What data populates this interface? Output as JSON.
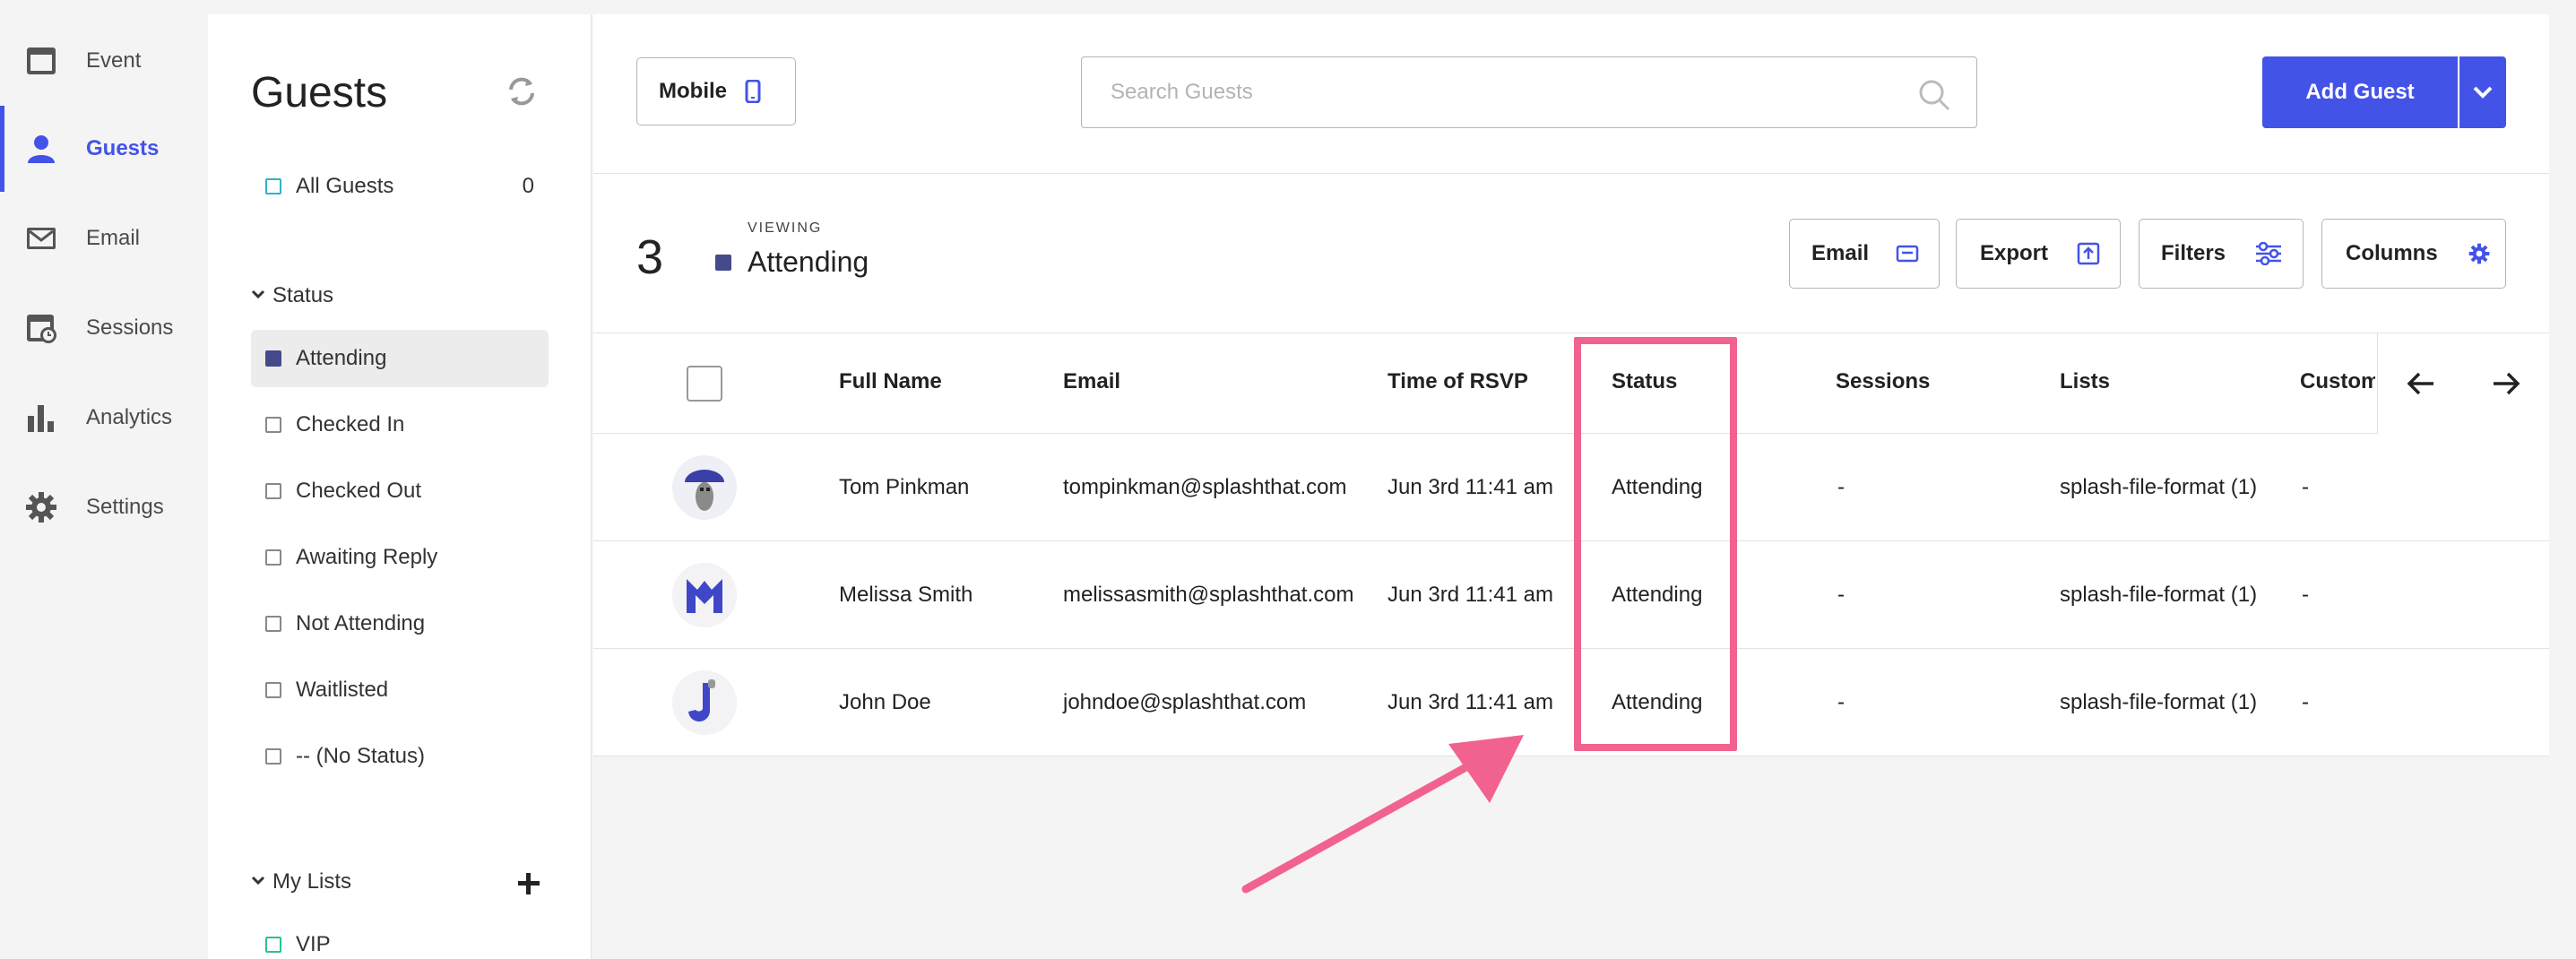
{
  "nav": {
    "items": [
      {
        "label": "Event",
        "icon": "calendar-icon"
      },
      {
        "label": "Guests",
        "icon": "person-icon"
      },
      {
        "label": "Email",
        "icon": "envelope-icon"
      },
      {
        "label": "Sessions",
        "icon": "sessions-clock-icon"
      },
      {
        "label": "Analytics",
        "icon": "bar-chart-icon"
      },
      {
        "label": "Settings",
        "icon": "gear-icon"
      }
    ],
    "active": "Guests",
    "accent_color": "#4353e8"
  },
  "sidebar": {
    "title": "Guests",
    "all_guests": {
      "label": "All Guests",
      "count": "0"
    },
    "status_group": {
      "label": "Status"
    },
    "statuses": [
      {
        "label": "Attending",
        "selected": true
      },
      {
        "label": "Checked In"
      },
      {
        "label": "Checked Out"
      },
      {
        "label": "Awaiting Reply"
      },
      {
        "label": "Not Attending"
      },
      {
        "label": "Waitlisted"
      },
      {
        "label": "-- (No Status)"
      }
    ],
    "lists_group": {
      "label": "My Lists"
    },
    "lists": [
      {
        "label": "VIP"
      }
    ]
  },
  "toolbar": {
    "mobile_label": "Mobile",
    "search_placeholder": "Search Guests",
    "add_guest_label": "Add Guest"
  },
  "summary": {
    "count": "3",
    "viewing_label": "VIEWING",
    "viewing_value": "Attending",
    "buttons": {
      "email": "Email",
      "export": "Export",
      "filters": "Filters",
      "columns": "Columns"
    }
  },
  "table": {
    "columns": [
      "Full Name",
      "Email",
      "Time of RSVP",
      "Status",
      "Sessions",
      "Lists",
      "Custom:"
    ],
    "rows": [
      {
        "name": "Tom Pinkman",
        "email": "tompinkman@splashthat.com",
        "time": "Jun 3rd 11:41 am",
        "status": "Attending",
        "sessions": "-",
        "lists": "splash-file-format (1)",
        "custom": "-"
      },
      {
        "name": "Melissa Smith",
        "email": "melissasmith@splashthat.com",
        "time": "Jun 3rd 11:41 am",
        "status": "Attending",
        "sessions": "-",
        "lists": "splash-file-format (1)",
        "custom": "-"
      },
      {
        "name": "John Doe",
        "email": "johndoe@splashthat.com",
        "time": "Jun 3rd 11:41 am",
        "status": "Attending",
        "sessions": "-",
        "lists": "splash-file-format (1)",
        "custom": "-"
      }
    ]
  },
  "annotation_color": "#f2628e"
}
